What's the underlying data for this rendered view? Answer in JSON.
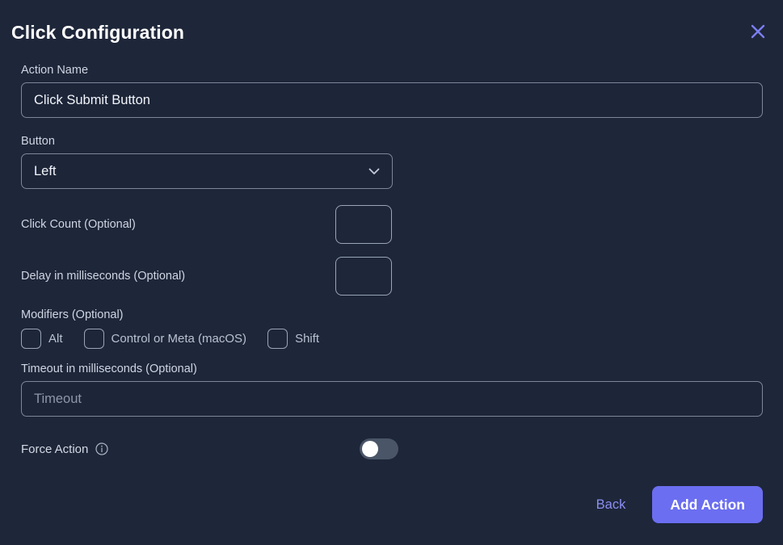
{
  "dialog": {
    "title": "Click Configuration",
    "close_icon": "close-icon"
  },
  "fields": {
    "action_name": {
      "label": "Action Name",
      "value": "Click Submit Button",
      "placeholder": ""
    },
    "button": {
      "label": "Button",
      "value": "Left",
      "chevron_icon": "chevron-down-icon"
    },
    "click_count": {
      "label": "Click Count (Optional)",
      "value": "",
      "placeholder": ""
    },
    "delay": {
      "label": "Delay in milliseconds (Optional)",
      "value": "",
      "placeholder": ""
    },
    "modifiers": {
      "label": "Modifiers (Optional)",
      "options": [
        {
          "label": "Alt",
          "checked": false
        },
        {
          "label": "Control or Meta (macOS)",
          "checked": false
        },
        {
          "label": "Shift",
          "checked": false
        }
      ]
    },
    "timeout": {
      "label": "Timeout in milliseconds (Optional)",
      "value": "",
      "placeholder": "Timeout"
    },
    "force_action": {
      "label": "Force Action",
      "info_icon": "info-icon",
      "enabled": false
    }
  },
  "footer": {
    "back_label": "Back",
    "add_action_label": "Add Action"
  },
  "colors": {
    "background": "#1e2639",
    "accent": "#6b6ef0",
    "link": "#8b8ff2",
    "border": "#7d8798",
    "toggle_track": "#4a5568"
  }
}
